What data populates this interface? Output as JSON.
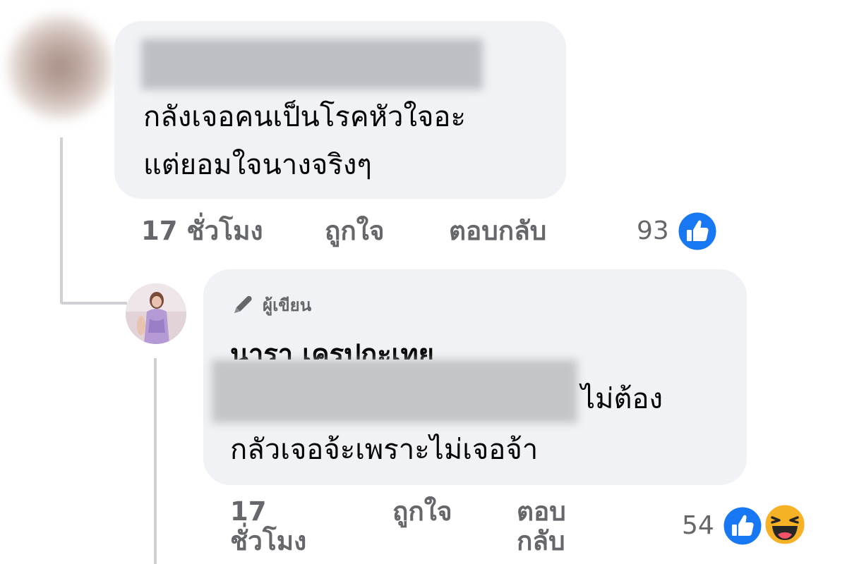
{
  "comment": {
    "text_line1": "กลังเจอคนเป็นโรคหัวใจอะ",
    "text_line2": "แต่ยอมใจนางจริงๆ",
    "time": "17 ชั่วโมง",
    "like_label": "ถูกใจ",
    "reply_label": "ตอบกลับ",
    "reaction_count": "93",
    "reactions": [
      "like-icon"
    ]
  },
  "reply": {
    "author_badge": "ผู้เขียน",
    "author_name": "นารา เครปกะเทย",
    "text_line1": "ไม่ต้อง",
    "text_line2": "กลัวเจอจ้ะเพราะไม่เจอจ้า",
    "time_line1": "17",
    "time_line2": "ชั่วโมง",
    "like_label": "ถูกใจ",
    "reply_line1": "ตอบ",
    "reply_line2": "กลับ",
    "reaction_count": "54",
    "reactions": [
      "like-icon",
      "haha-icon"
    ]
  },
  "colors": {
    "bubble": "#f0f2f5",
    "meta_text": "#65676b",
    "like_blue": "#1877f2",
    "haha_yellow": "#f7b125"
  }
}
